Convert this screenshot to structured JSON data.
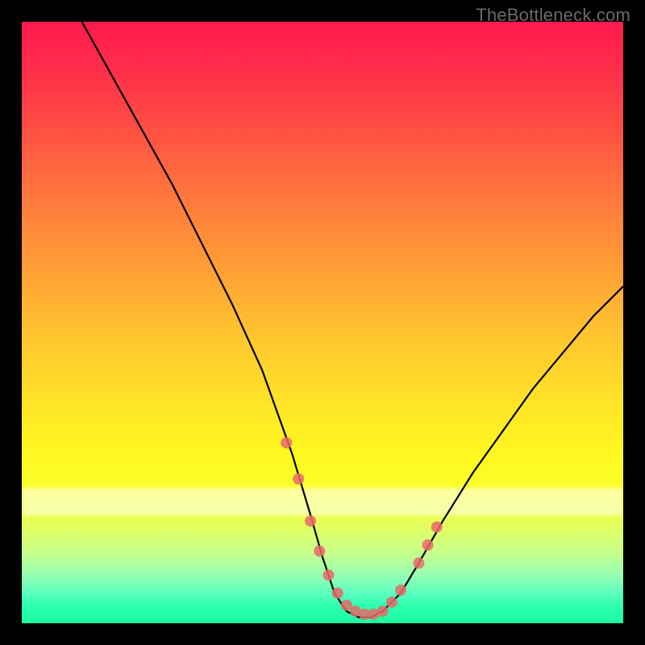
{
  "watermark": "TheBottleneck.com",
  "chart_data": {
    "type": "line",
    "title": "",
    "xlabel": "",
    "ylabel": "",
    "xlim": [
      0,
      100
    ],
    "ylim": [
      0,
      100
    ],
    "series": [
      {
        "name": "bottleneck-curve",
        "x": [
          10,
          15,
          20,
          25,
          30,
          35,
          40,
          45,
          48,
          50,
          52,
          54,
          56,
          58,
          60,
          63,
          66,
          70,
          75,
          80,
          85,
          90,
          95,
          100
        ],
        "y": [
          100,
          91,
          82,
          73,
          63,
          53,
          42,
          28,
          18,
          11,
          5,
          2,
          1,
          1,
          2,
          5,
          10,
          17,
          25,
          32,
          39,
          45,
          51,
          56
        ]
      }
    ],
    "markers": {
      "name": "highlighted-points",
      "color": "#e86a6a",
      "x": [
        44,
        46,
        48,
        49.5,
        51,
        52.5,
        54,
        55.5,
        57,
        58.5,
        60,
        61.5,
        63,
        66,
        67.5,
        69
      ],
      "y": [
        30,
        24,
        17,
        12,
        8,
        5,
        3,
        2,
        1.5,
        1.5,
        2,
        3.5,
        5.5,
        10,
        13,
        16
      ]
    },
    "gradient_stops": [
      {
        "pos": 0,
        "color": "#ff1a4d"
      },
      {
        "pos": 50,
        "color": "#ffc42f"
      },
      {
        "pos": 80,
        "color": "#fbff2a"
      },
      {
        "pos": 100,
        "color": "#1affa0"
      }
    ]
  }
}
